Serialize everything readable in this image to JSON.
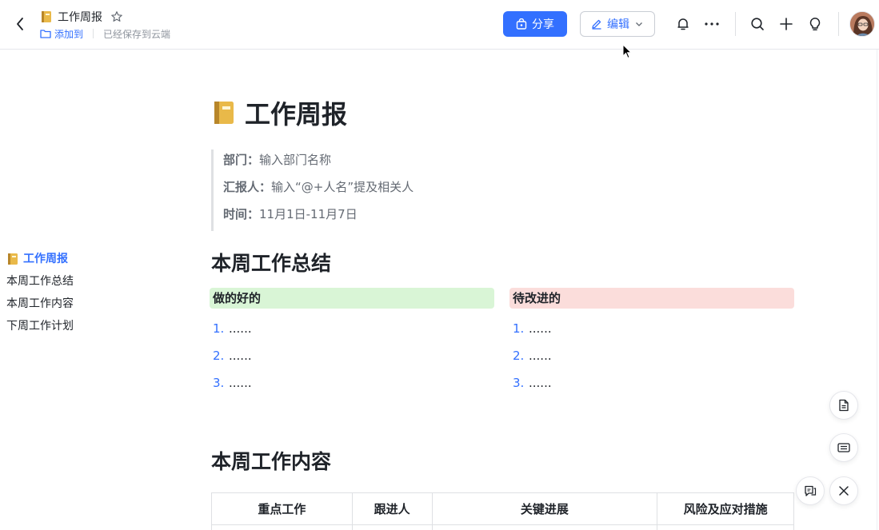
{
  "header": {
    "doc_title": "工作周报",
    "add_to_label": "添加到",
    "saved_status": "已经保存到云端",
    "share_label": "分享",
    "edit_label": "编辑"
  },
  "outline": {
    "items": [
      {
        "label": "工作周报",
        "active": true
      },
      {
        "label": "本周工作总结"
      },
      {
        "label": "本周工作内容"
      },
      {
        "label": "下周工作计划"
      }
    ]
  },
  "document": {
    "title": "工作周报",
    "meta": [
      {
        "key": "部门：",
        "value": "输入部门名称"
      },
      {
        "key": "汇报人：",
        "value": "输入“@+人名”提及相关人"
      },
      {
        "key": "时间：",
        "value": "11月1日-11月7日"
      }
    ],
    "section1_title": "本周工作总结",
    "good": {
      "title": "做的好的",
      "items": [
        {
          "num": "1.",
          "text": "......"
        },
        {
          "num": "2.",
          "text": "......"
        },
        {
          "num": "3.",
          "text": "......"
        }
      ]
    },
    "improve": {
      "title": "待改进的",
      "items": [
        {
          "num": "1.",
          "text": "......"
        },
        {
          "num": "2.",
          "text": "......"
        },
        {
          "num": "3.",
          "text": "......"
        }
      ]
    },
    "section2_title": "本周工作内容",
    "table_headers": [
      "重点工作",
      "跟进人",
      "关键进展",
      "风险及应对措施"
    ]
  },
  "colors": {
    "accent": "#3370ff",
    "good_bg": "#d9f5d6",
    "improve_bg": "#fbdddb"
  }
}
